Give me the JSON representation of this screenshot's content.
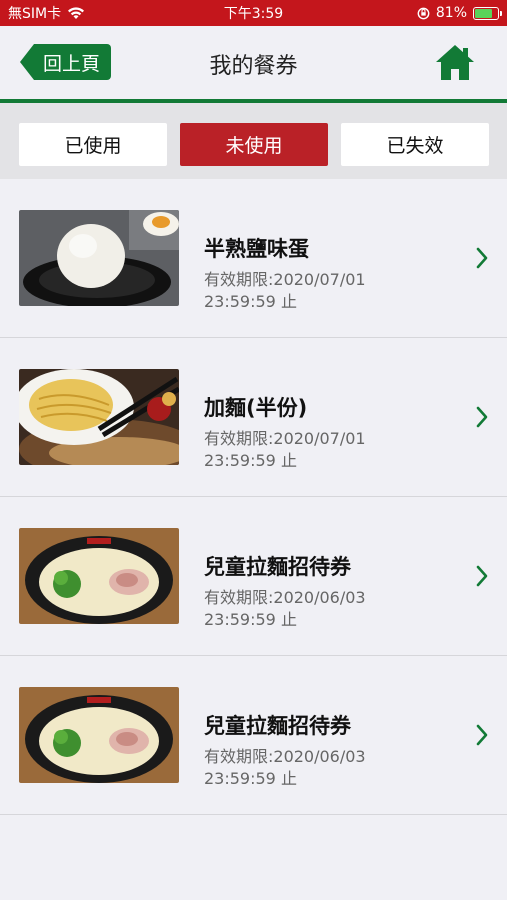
{
  "status_bar": {
    "carrier": "無SIM卡",
    "time": "下午3:59",
    "battery_pct": "81%",
    "battery_level": 0.81
  },
  "nav": {
    "back_label": "回上頁",
    "title": "我的餐券"
  },
  "tabs": [
    {
      "label": "已使用",
      "active": false
    },
    {
      "label": "未使用",
      "active": true
    },
    {
      "label": "已失效",
      "active": false
    }
  ],
  "coupons": [
    {
      "title": "半熟鹽味蛋",
      "expiry": "有效期限:2020/07/01 23:59:59 止",
      "image": "egg"
    },
    {
      "title": "加麵(半份)",
      "expiry": "有效期限:2020/07/01 23:59:59 止",
      "image": "noodles"
    },
    {
      "title": "兒童拉麵招待券",
      "expiry": "有效期限:2020/06/03 23:59:59 止",
      "image": "ramen"
    },
    {
      "title": "兒童拉麵招待券",
      "expiry": "有效期限:2020/06/03 23:59:59 止",
      "image": "ramen"
    }
  ],
  "colors": {
    "status_bar": "#c4161c",
    "brand_green": "#127a36",
    "tab_active": "#ba2127"
  }
}
